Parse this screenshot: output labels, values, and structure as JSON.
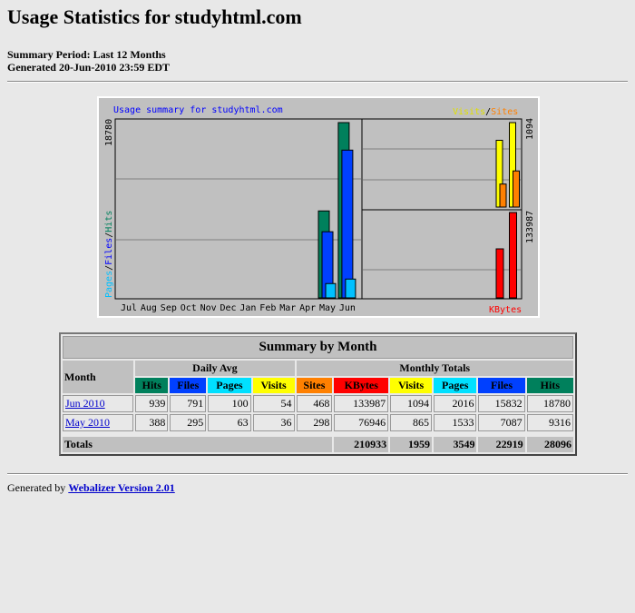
{
  "title": "Usage Statistics for studyhtml.com",
  "summary_period": "Summary Period: Last 12 Months",
  "generated": "Generated 20-Jun-2010 23:59 EDT",
  "colors": {
    "hits": "#00805c",
    "files": "#0040ff",
    "pages": "#00e0ff",
    "visits": "#ffff00",
    "sites": "#ff8000",
    "kbytes": "#ff0000"
  },
  "chart_data": {
    "type": "bar",
    "title": "Usage summary for studyhtml.com",
    "categories": [
      "Jul",
      "Aug",
      "Sep",
      "Oct",
      "Nov",
      "Dec",
      "Jan",
      "Feb",
      "Mar",
      "Apr",
      "May",
      "Jun"
    ],
    "left_axis_label": {
      "pages": "Pages",
      "sep": "/",
      "files": "Files",
      "sep2": "/",
      "hits": "Hits"
    },
    "right_top_label": {
      "visits": "Visits",
      "sep": "/",
      "sites": "Sites"
    },
    "right_bottom_label": "KBytes",
    "max_hits_label": "18780",
    "max_visits_label": "1094",
    "max_kbytes_label": "133987",
    "series": [
      {
        "name": "Hits",
        "values": [
          0,
          0,
          0,
          0,
          0,
          0,
          0,
          0,
          0,
          0,
          9316,
          18780
        ]
      },
      {
        "name": "Files",
        "values": [
          0,
          0,
          0,
          0,
          0,
          0,
          0,
          0,
          0,
          0,
          7087,
          15832
        ]
      },
      {
        "name": "Pages",
        "values": [
          0,
          0,
          0,
          0,
          0,
          0,
          0,
          0,
          0,
          0,
          1533,
          2016
        ]
      },
      {
        "name": "Visits",
        "values": [
          0,
          0,
          0,
          0,
          0,
          0,
          0,
          0,
          0,
          0,
          865,
          1094
        ]
      },
      {
        "name": "Sites",
        "values": [
          0,
          0,
          0,
          0,
          0,
          0,
          0,
          0,
          0,
          0,
          298,
          468
        ]
      },
      {
        "name": "KBytes",
        "values": [
          0,
          0,
          0,
          0,
          0,
          0,
          0,
          0,
          0,
          0,
          76946,
          133987
        ]
      }
    ]
  },
  "table": {
    "title": "Summary by Month",
    "month_header": "Month",
    "daily_avg": "Daily Avg",
    "monthly_totals": "Monthly Totals",
    "cols": [
      "Hits",
      "Files",
      "Pages",
      "Visits",
      "Sites",
      "KBytes",
      "Visits",
      "Pages",
      "Files",
      "Hits"
    ],
    "rows": [
      {
        "month": "Jun 2010",
        "values": [
          "939",
          "791",
          "100",
          "54",
          "468",
          "133987",
          "1094",
          "2016",
          "15832",
          "18780"
        ]
      },
      {
        "month": "May 2010",
        "values": [
          "388",
          "295",
          "63",
          "36",
          "298",
          "76946",
          "865",
          "1533",
          "7087",
          "9316"
        ]
      }
    ],
    "totals_label": "Totals",
    "totals": [
      "210933",
      "1959",
      "3549",
      "22919",
      "28096"
    ]
  },
  "footer": {
    "prefix": "Generated by",
    "link": "Webalizer Version 2.01"
  }
}
